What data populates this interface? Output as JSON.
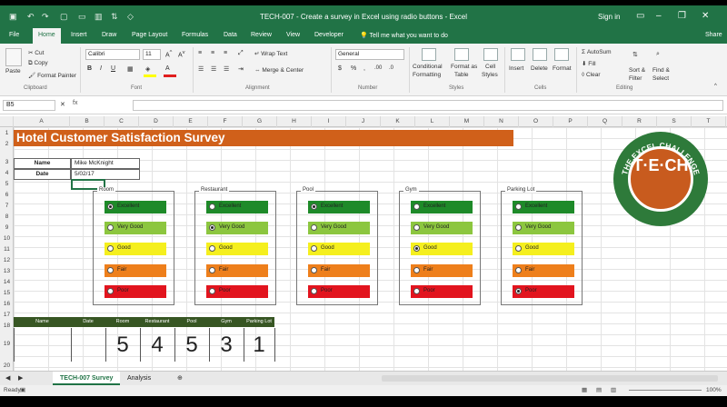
{
  "window": {
    "title": "TECH-007 - Create a survey in Excel using radio buttons - Excel",
    "signin": "Sign in",
    "qat_icons": [
      "save-icon",
      "undo-icon",
      "redo-icon",
      "new-icon",
      "open-icon",
      "chart-icon",
      "sort-icon",
      "shape-icon"
    ]
  },
  "tabs": [
    "File",
    "Home",
    "Insert",
    "Draw",
    "Page Layout",
    "Formulas",
    "Data",
    "Review",
    "View",
    "Developer"
  ],
  "tellme": "Tell me what you want to do",
  "share": "Share",
  "ribbon": {
    "paste": "Paste",
    "cut": "Cut",
    "copy": "Copy",
    "format_painter": "Format Painter",
    "clipboard": "Clipboard",
    "font_name": "Calibri",
    "font_size": "11",
    "font": "Font",
    "wrap_text": "Wrap Text",
    "merge_center": "Merge & Center",
    "alignment": "Alignment",
    "number_format": "General",
    "number": "Number",
    "conditional": "Conditional",
    "formatting": "Formatting",
    "format_as": "Format as",
    "table": "Table",
    "cell": "Cell",
    "styles_btn": "Styles",
    "styles": "Styles",
    "insert": "Insert",
    "delete": "Delete",
    "format": "Format",
    "cells": "Cells",
    "autosum": "AutoSum",
    "fill": "Fill",
    "clear": "Clear",
    "sort": "Sort &",
    "filter": "Filter",
    "find": "Find &",
    "select": "Select",
    "editing": "Editing"
  },
  "formula_bar": {
    "name_box": "B5",
    "fx": "fx",
    "content": ""
  },
  "columns": [
    "A",
    "B",
    "C",
    "D",
    "E",
    "F",
    "G",
    "H",
    "I",
    "J",
    "K",
    "L",
    "M",
    "N",
    "O",
    "P",
    "Q",
    "R",
    "S",
    "T"
  ],
  "rows": [
    "1",
    "2",
    "3",
    "4",
    "5",
    "6",
    "7",
    "8",
    "9",
    "10",
    "11",
    "12",
    "13",
    "14",
    "15",
    "16",
    "17",
    "18",
    "19",
    "20"
  ],
  "survey": {
    "title": "Hotel Customer Satisfaction Survey",
    "name_label": "Name",
    "name_value": "Mike McKnight",
    "date_label": "Date",
    "date_value": "5/02/17"
  },
  "options": [
    {
      "label": "Excellent",
      "color": "#1e8a29"
    },
    {
      "label": "Very Good",
      "color": "#8cc63f"
    },
    {
      "label": "Good",
      "color": "#f5ef1e"
    },
    {
      "label": "Fair",
      "color": "#ee7f1b"
    },
    {
      "label": "Poor",
      "color": "#e2141e"
    }
  ],
  "groups": [
    {
      "title": "Room",
      "selected": 0
    },
    {
      "title": "Restaurant",
      "selected": 1
    },
    {
      "title": "Pool",
      "selected": 0
    },
    {
      "title": "Gym",
      "selected": 2
    },
    {
      "title": "Parking Lot",
      "selected": 4
    }
  ],
  "summary": {
    "headers": [
      "Name",
      "Date",
      "Room",
      "Restaurant",
      "Pool",
      "Gym",
      "Parking Lot"
    ],
    "values": [
      "",
      "",
      "5",
      "4",
      "5",
      "3",
      "1"
    ],
    "header_color": "#375623"
  },
  "logo": {
    "text": "T·E·CH",
    "ring_text": "THE EXCEL CHALLENGE"
  },
  "sheets": [
    "TECH-007 Survey",
    "Analysis"
  ],
  "status": {
    "ready": "Ready",
    "zoom": "100%"
  }
}
